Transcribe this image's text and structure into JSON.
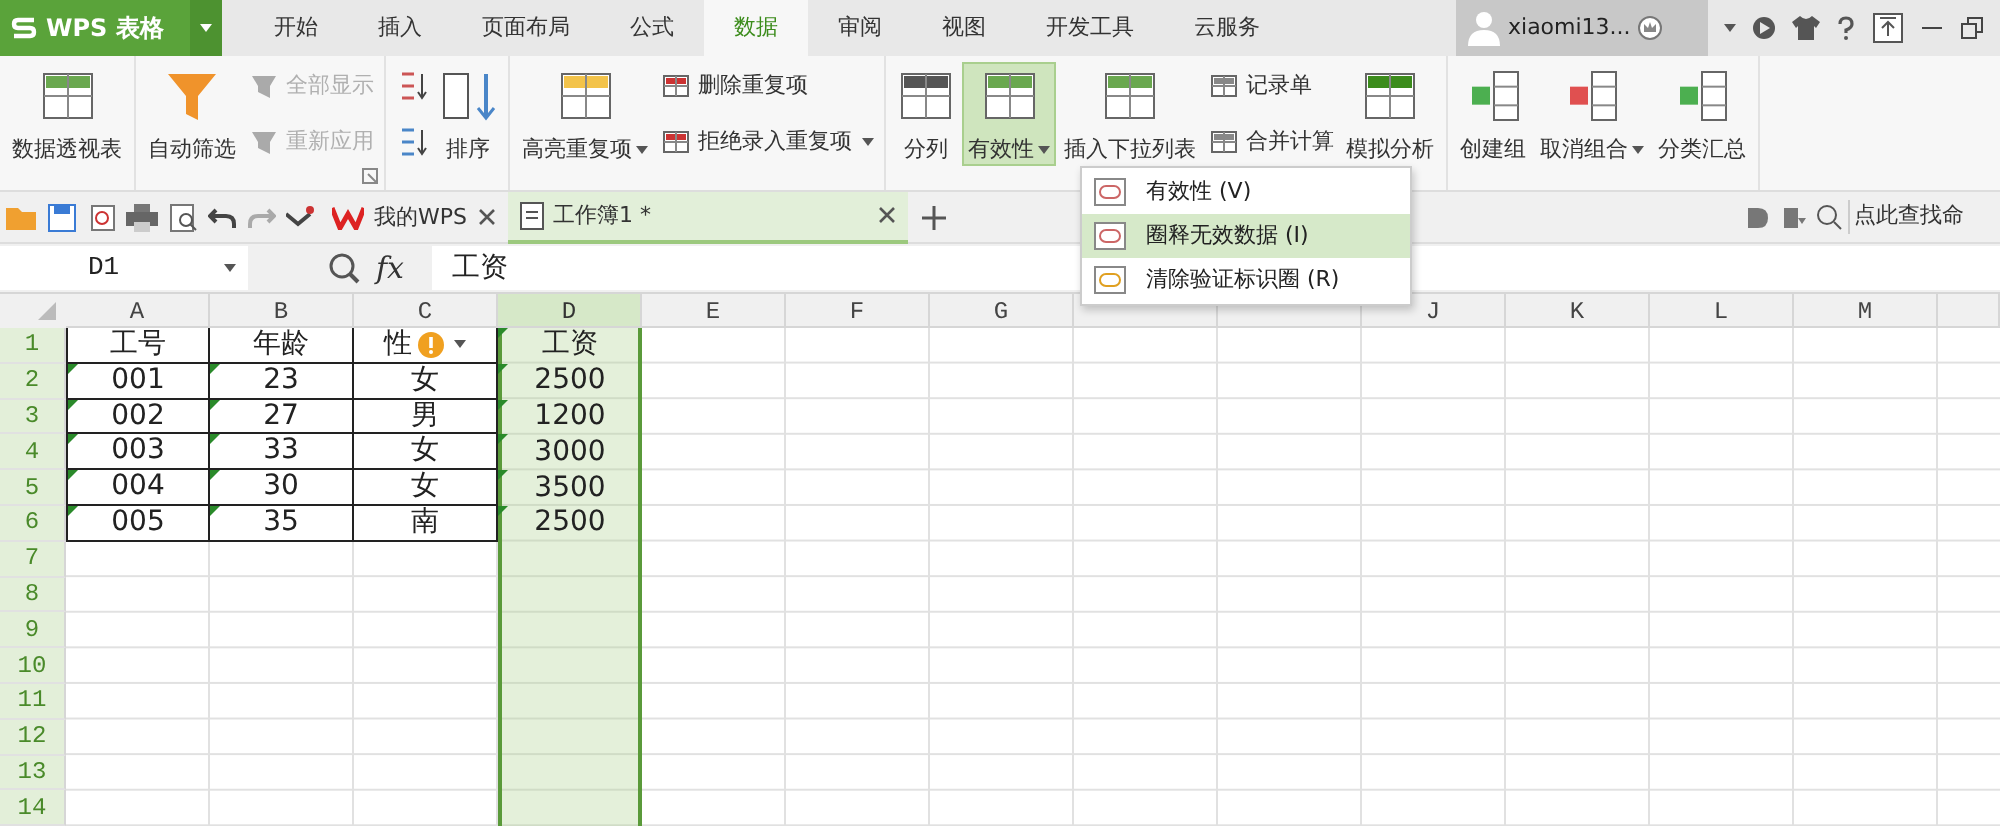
{
  "app_button": {
    "label": "WPS 表格"
  },
  "menu_tabs": [
    {
      "label": "开始",
      "selected": false
    },
    {
      "label": "插入",
      "selected": false
    },
    {
      "label": "页面布局",
      "selected": false
    },
    {
      "label": "公式",
      "selected": false
    },
    {
      "label": "数据",
      "selected": true
    },
    {
      "label": "审阅",
      "selected": false
    },
    {
      "label": "视图",
      "selected": false
    },
    {
      "label": "开发工具",
      "selected": false
    },
    {
      "label": "云服务",
      "selected": false
    }
  ],
  "account": {
    "username": "xiaomi13..."
  },
  "ribbon": [
    {
      "items": [
        {
          "kind": "large",
          "label": "数据透视表"
        }
      ]
    },
    {
      "launcher": true,
      "items": [
        {
          "kind": "large",
          "label": "自动筛选"
        },
        {
          "kind": "stack",
          "items": [
            {
              "label": "全部显示",
              "disabled": true
            },
            {
              "label": "重新应用",
              "disabled": true
            }
          ]
        }
      ]
    },
    {
      "items": [
        {
          "kind": "sort",
          "label": "排序"
        }
      ]
    },
    {
      "items": [
        {
          "kind": "large",
          "label": "高亮重复项",
          "dropdown": true
        },
        {
          "kind": "stack",
          "items": [
            {
              "label": "删除重复项"
            },
            {
              "label": "拒绝录入重复项",
              "dropdown": true
            }
          ]
        }
      ]
    },
    {
      "items": [
        {
          "kind": "large",
          "label": "分列"
        },
        {
          "kind": "large",
          "label": "有效性",
          "dropdown": true,
          "pressed": true
        },
        {
          "kind": "large",
          "label": "插入下拉列表"
        },
        {
          "kind": "stack",
          "items": [
            {
              "label": "记录单"
            },
            {
              "label": "合并计算"
            }
          ]
        },
        {
          "kind": "large",
          "label": "模拟分析"
        }
      ]
    },
    {
      "items": [
        {
          "kind": "large",
          "label": "创建组"
        },
        {
          "kind": "large",
          "label": "取消组合",
          "dropdown": true
        },
        {
          "kind": "large",
          "label": "分类汇总"
        }
      ]
    }
  ],
  "doc_tabs": [
    {
      "label": "我的WPS",
      "selected": false
    },
    {
      "label": "工作簿1 *",
      "selected": true
    }
  ],
  "search": {
    "placeholder": "点此查找命"
  },
  "formula_bar": {
    "name_box": "D1",
    "function_label": "fx",
    "content": "工资"
  },
  "dropdown_menu": [
    {
      "label": "有效性",
      "accelerator": "(V)",
      "selected": false
    },
    {
      "label": "圈释无效数据",
      "accelerator": "(I)",
      "selected": true
    },
    {
      "label": "清除验证标识圈",
      "accelerator": "(R)",
      "selected": false
    }
  ],
  "sheet": {
    "columns": [
      {
        "label": "A",
        "selected": false
      },
      {
        "label": "B",
        "selected": false
      },
      {
        "label": "C",
        "selected": false
      },
      {
        "label": "D",
        "selected": true
      },
      {
        "label": "E",
        "selected": false
      },
      {
        "label": "F",
        "selected": false
      },
      {
        "label": "G",
        "selected": false
      },
      {
        "selected": false
      },
      {
        "selected": false
      },
      {
        "label": "J",
        "selected": false
      },
      {
        "label": "K",
        "selected": false
      },
      {
        "label": "L",
        "selected": false
      },
      {
        "label": "M",
        "selected": false
      }
    ],
    "rows": [
      {
        "label": "1",
        "cells": [
          {
            "text": "工号"
          },
          {
            "text": "年龄"
          },
          {
            "text": "性",
            "warning": true
          },
          {
            "text": "工资",
            "flag": true
          }
        ]
      },
      {
        "label": "2",
        "cells": [
          {
            "text": "001",
            "flag": true
          },
          {
            "text": "23",
            "flag": true
          },
          {
            "text": "女"
          },
          {
            "text": "2500",
            "flag": true
          }
        ]
      },
      {
        "label": "3",
        "cells": [
          {
            "text": "002",
            "flag": true
          },
          {
            "text": "27",
            "flag": true
          },
          {
            "text": "男"
          },
          {
            "text": "1200",
            "flag": true
          }
        ]
      },
      {
        "label": "4",
        "cells": [
          {
            "text": "003",
            "flag": true
          },
          {
            "text": "33",
            "flag": true
          },
          {
            "text": "女"
          },
          {
            "text": "3000",
            "flag": true
          }
        ]
      },
      {
        "label": "5",
        "cells": [
          {
            "text": "004",
            "flag": true
          },
          {
            "text": "30",
            "flag": true
          },
          {
            "text": "女"
          },
          {
            "text": "3500",
            "flag": true
          }
        ]
      },
      {
        "label": "6",
        "cells": [
          {
            "text": "005",
            "flag": true
          },
          {
            "text": "35",
            "flag": true
          },
          {
            "text": "南"
          },
          {
            "text": "2500",
            "flag": true
          }
        ]
      },
      {
        "label": "7",
        "cells": []
      },
      {
        "label": "8",
        "cells": []
      },
      {
        "label": "9",
        "cells": []
      },
      {
        "label": "10",
        "cells": []
      },
      {
        "label": "11",
        "cells": []
      },
      {
        "label": "12",
        "cells": []
      },
      {
        "label": "13",
        "cells": []
      },
      {
        "label": "14",
        "cells": []
      }
    ]
  }
}
